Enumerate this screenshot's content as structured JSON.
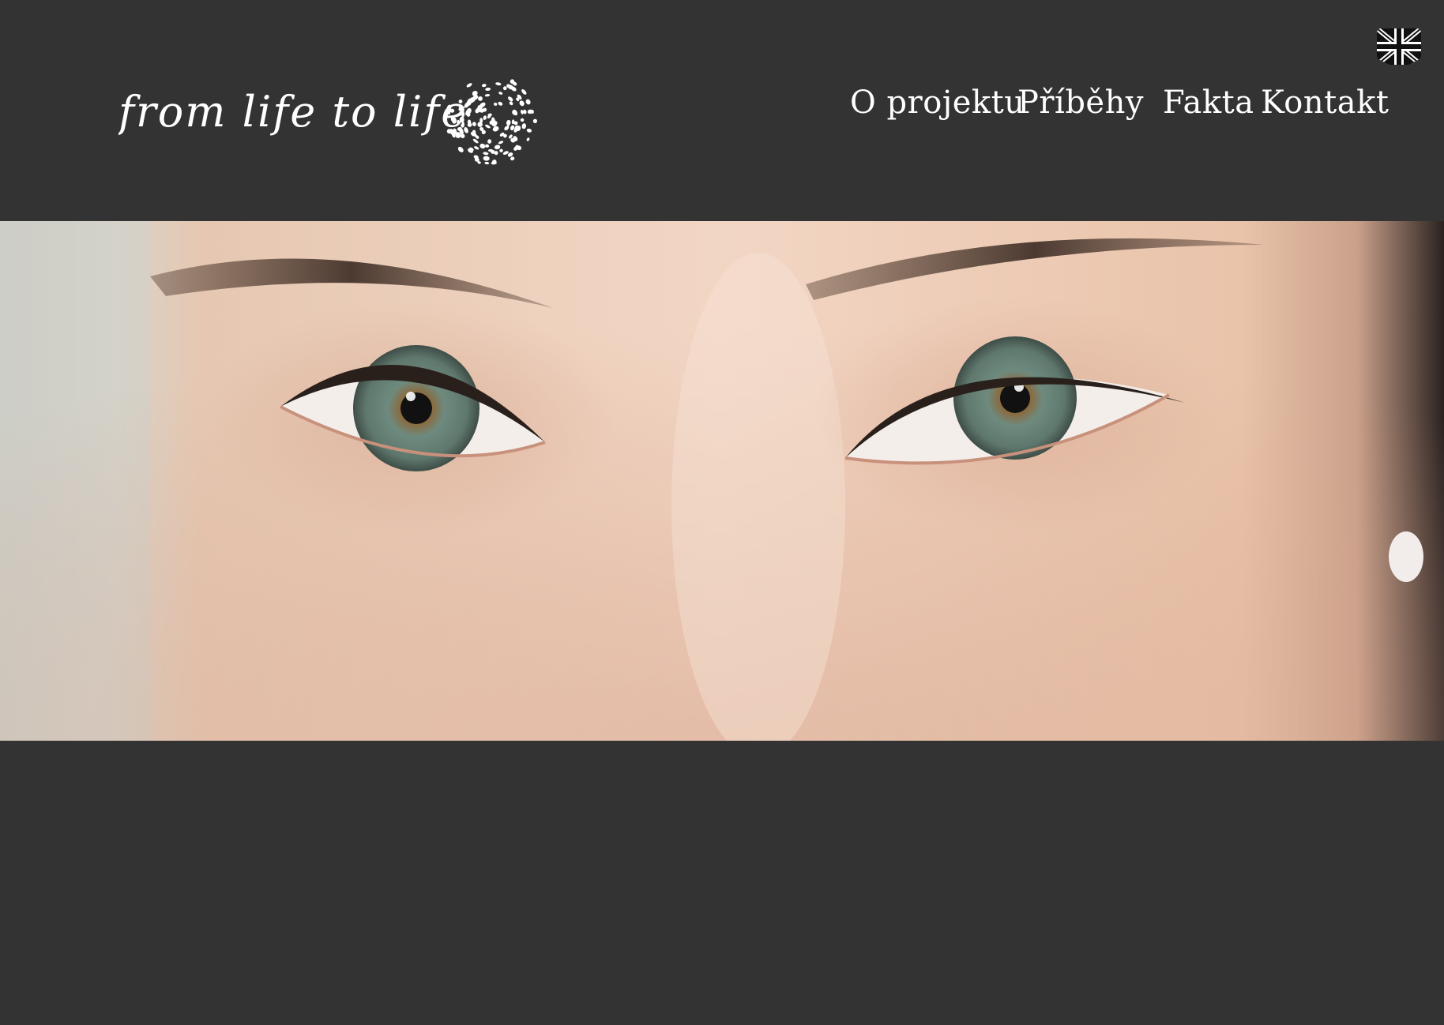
{
  "site": {
    "brand": "from life to life",
    "background_color": "#333333",
    "text_color": "#ffffff"
  },
  "nav": {
    "items": [
      {
        "label": "O projektu"
      },
      {
        "label": "Příběhy"
      },
      {
        "label": "Fakta"
      },
      {
        "label": "Kontakt"
      }
    ]
  },
  "language_switch": {
    "icon": "uk-flag-icon"
  },
  "hero": {
    "image": "close-up-eyes-photo"
  }
}
